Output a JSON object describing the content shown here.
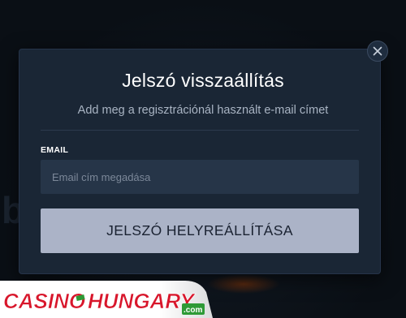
{
  "modal": {
    "title": "Jelszó visszaállítás",
    "subtitle": "Add meg a regisztrációnál használt e-mail címet",
    "email_label": "EMAIL",
    "email_placeholder": "Email cím megadása",
    "email_value": "",
    "submit_label": "JELSZÓ HELYREÁLLÍTÁSA",
    "close_icon": "close-icon"
  },
  "watermark": {
    "word_casino": "Casino",
    "word_hungary": "Hungary",
    "suffix": ".com"
  },
  "colors": {
    "modal_bg": "#1a2635",
    "input_bg": "#263548",
    "button_bg": "#abb3c7",
    "logo_red": "#d8162b",
    "logo_green": "#2e9a36"
  }
}
